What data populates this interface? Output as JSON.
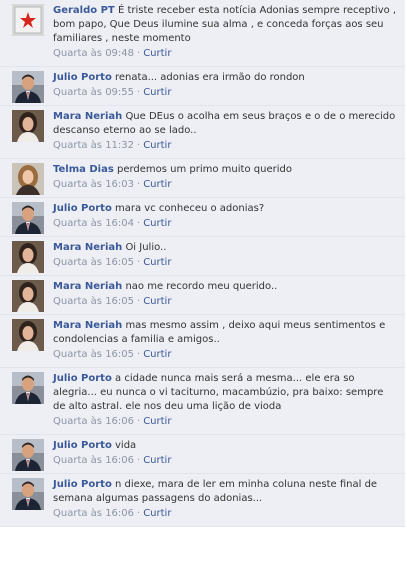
{
  "comments": [
    {
      "author": "Geraldo PT",
      "avatar": "flag-avatar",
      "text": "É triste receber esta notícia Adonias sempre receptivo , bom papo, Que Deus ilumine sua alma , e conceda forças aos seu familiares , neste momento",
      "time": "Quarta às 09:48",
      "like": "Curtir"
    },
    {
      "author": "Julio Porto",
      "avatar": "man-suit-avatar",
      "text": "renata... adonias era irmão do rondon",
      "time": "Quarta às 09:55",
      "like": "Curtir"
    },
    {
      "author": "Mara Neriah",
      "avatar": "woman-avatar",
      "text": "Que DEus o acolha em seus braços e o de o merecido descanso eterno ao se lado..",
      "time": "Quarta às 11:32",
      "like": "Curtir"
    },
    {
      "author": "Telma Dias",
      "avatar": "woman-blonde-avatar",
      "text": "perdemos um primo muito querido",
      "time": "Quarta às 16:03",
      "like": "Curtir"
    },
    {
      "author": "Julio Porto",
      "avatar": "man-suit-avatar",
      "text": "mara vc conheceu o adonias?",
      "time": "Quarta às 16:04",
      "like": "Curtir"
    },
    {
      "author": "Mara Neriah",
      "avatar": "woman-avatar",
      "text": "Oi Julio..",
      "time": "Quarta às 16:05",
      "like": "Curtir"
    },
    {
      "author": "Mara Neriah",
      "avatar": "woman-avatar",
      "text": "nao me recordo meu querido..",
      "time": "Quarta às 16:05",
      "like": "Curtir"
    },
    {
      "author": "Mara Neriah",
      "avatar": "woman-avatar",
      "text": "mas mesmo assim , deixo aqui meus sentimentos e condolencias a familia e amigos..",
      "time": "Quarta às 16:05",
      "like": "Curtir"
    },
    {
      "author": "Julio Porto",
      "avatar": "man-suit-avatar",
      "text": "a cidade nunca mais será a mesma... ele era so alegria... eu nunca o vi taciturno, macambúzio, pra baixo: sempre de alto astral. ele nos deu uma lição de vioda",
      "time": "Quarta às 16:06",
      "like": "Curtir"
    },
    {
      "author": "Julio Porto",
      "avatar": "man-suit-avatar",
      "text": "vida",
      "time": "Quarta às 16:06",
      "like": "Curtir"
    },
    {
      "author": "Julio Porto",
      "avatar": "man-suit-avatar",
      "text": "n diexe, mara de ler em minha coluna neste final de semana algumas passagens do adonias...",
      "time": "Quarta às 16:06",
      "like": "Curtir"
    }
  ],
  "meta_separator": "·",
  "colors": {
    "background": "#edeff4",
    "author_link": "#3b5998",
    "timestamp": "#8d94a4",
    "divider": "#e1e4ea"
  }
}
